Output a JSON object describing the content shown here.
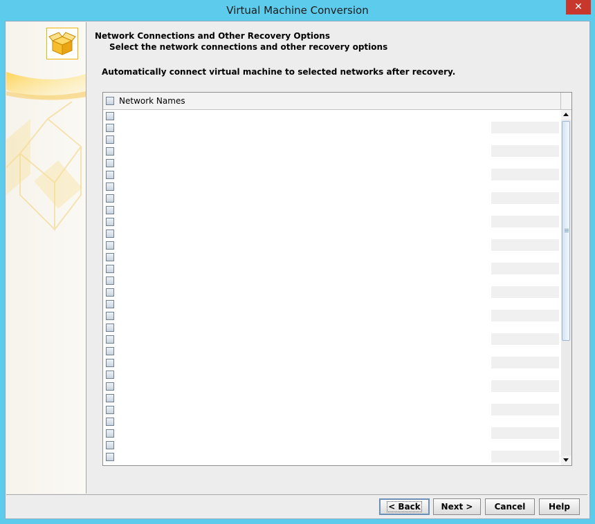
{
  "window": {
    "title": "Virtual Machine Conversion",
    "close_glyph": "✕"
  },
  "header": {
    "title": "Network Connections and Other Recovery Options",
    "subtitle": "Select the network connections and other recovery options"
  },
  "auto_connect_text": "Automatically connect virtual machine to selected networks after recovery.",
  "table": {
    "column_header": "Network Names",
    "row_count": 30,
    "truncated_row_text": "... ... ... ... ... ... ... ... ... ... ... ... ... ... ..."
  },
  "buttons": {
    "back": "< Back",
    "next": "Next >",
    "cancel": "Cancel",
    "help": "Help"
  },
  "colors": {
    "titlebar": "#5ccbec",
    "close": "#c7372c",
    "window_bg": "#ededed",
    "box_icon": "#f6bd2e"
  }
}
